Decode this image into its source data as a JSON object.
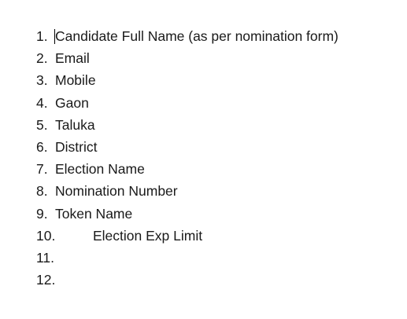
{
  "document": {
    "items": [
      {
        "number": "1.",
        "text": "Candidate Full Name (as per nomination form)"
      },
      {
        "number": "2.",
        "text": "Email"
      },
      {
        "number": "3.",
        "text": "Mobile"
      },
      {
        "number": "4.",
        "text": "Gaon"
      },
      {
        "number": "5.",
        "text": "Taluka"
      },
      {
        "number": "6.",
        "text": "District"
      },
      {
        "number": "7.",
        "text": "Election Name"
      },
      {
        "number": "8.",
        "text": "Nomination Number"
      },
      {
        "number": "9.",
        "text": "Token Name"
      },
      {
        "number": "10.",
        "text": "Election Exp Limit"
      },
      {
        "number": "11.",
        "text": ""
      },
      {
        "number": "12.",
        "text": ""
      }
    ]
  }
}
